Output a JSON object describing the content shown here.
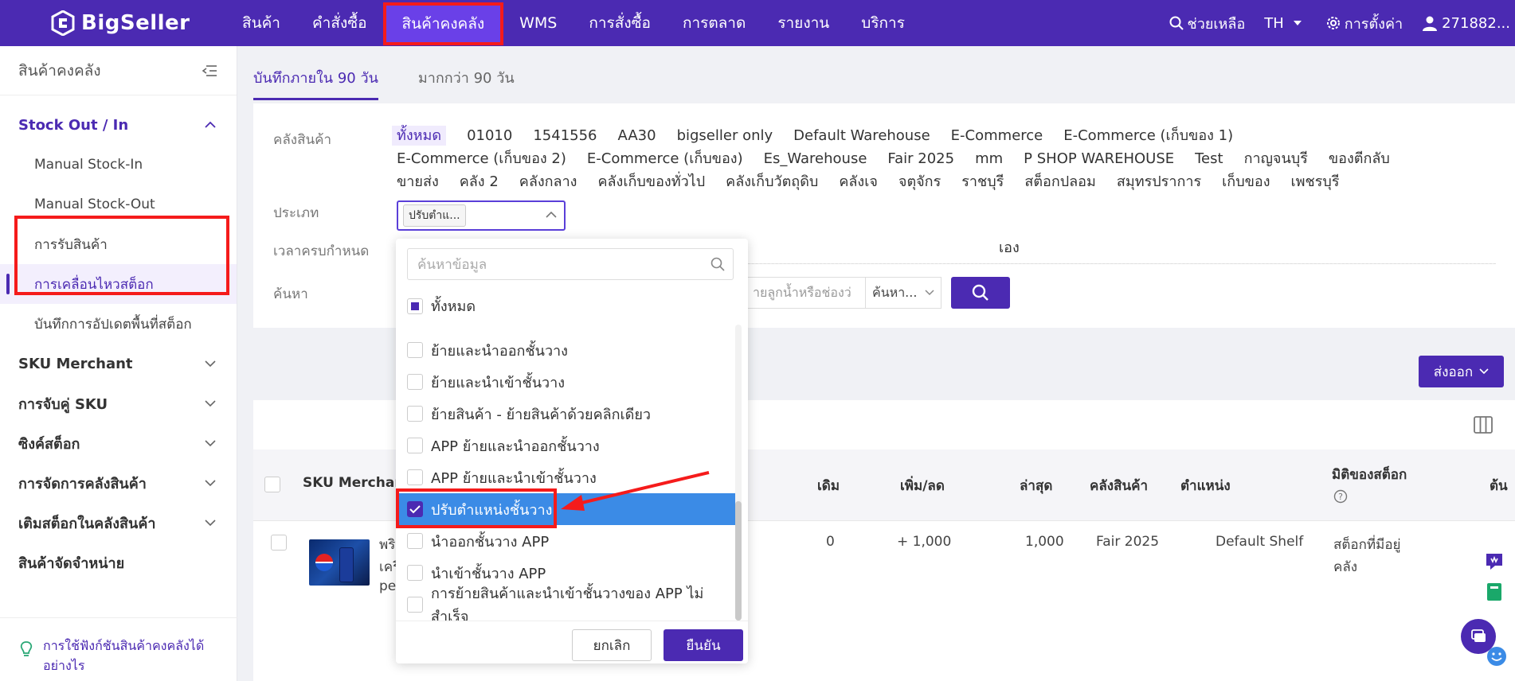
{
  "app": {
    "brand": "BigSeller",
    "nav": [
      "สินค้า",
      "คำสั่งซื้อ",
      "สินค้าคงคลัง",
      "WMS",
      "การสั่งซื้อ",
      "การตลาด",
      "รายงาน",
      "บริการ"
    ],
    "nav_active": "สินค้าคงคลัง",
    "help": "ช่วยเหลือ",
    "lang": "TH",
    "settings": "การตั้งค่า",
    "user": "271882..."
  },
  "sidebar": {
    "title": "สินค้าคงคลัง",
    "open_group": "Stock Out / In",
    "sub_items": [
      "Manual Stock-In",
      "Manual Stock-Out",
      "การรับสินค้า",
      "การเคลื่อนไหวสต็อก",
      "บันทึกการอัปเดตพื้นที่สต็อก"
    ],
    "active_sub": "การเคลื่อนไหวสต็อก",
    "groups": [
      "SKU Merchant",
      "การจับคู่ SKU",
      "ซิงค์สต็อก",
      "การจัดการคลังสินค้า",
      "เติมสต็อกในคลังสินค้า",
      "สินค้าจัดจำหน่าย"
    ],
    "footer": "การใช้ฟังก์ชันสินค้าคงคลังได้อย่างไร"
  },
  "tabs": [
    "บันทึกภายใน 90 วัน",
    "มากกว่า 90 วัน"
  ],
  "filters": {
    "warehouse_label": "คลังสินค้า",
    "warehouses": [
      "ทั้งหมด",
      "01010",
      "1541556",
      "AA30",
      "bigseller only",
      "Default Warehouse",
      "E-Commerce",
      "E-Commerce (เก็บของ 1)",
      "E-Commerce (เก็บของ 2)",
      "E-Commerce (เก็บของ)",
      "Es_Warehouse",
      "Fair 2025",
      "mm",
      "P SHOP WAREHOUSE",
      "Test",
      "กาญจนบุรี",
      "ของตีกลับ",
      "ขายส่ง",
      "คลัง 2",
      "คลังกลาง",
      "คลังเก็บของทั่วไป",
      "คลังเก็บวัตถุดิบ",
      "คลังเจ",
      "จตุจักร",
      "ราชบุรี",
      "สต็อกปลอม",
      "สมุทรปราการ",
      "เก็บของ",
      "เพชรบุรี"
    ],
    "type_label": "ประเภท",
    "type_chip": "ปรับตำแ...",
    "deadline_label": "เวลาครบกำหนด",
    "deadline_tail": "เอง",
    "search_label": "ค้นหา",
    "search_placeholder": "ายลูกน้ำหรือช่องว่",
    "search_mode": "ค้นหา..."
  },
  "dropdown": {
    "search_placeholder": "ค้นหาข้อมูล",
    "all_label": "ทั้งหมด",
    "items": [
      {
        "label": "ย้ายและนำออกชั้นวาง",
        "checked": false
      },
      {
        "label": "ย้ายและนำเข้าชั้นวาง",
        "checked": false
      },
      {
        "label": "ย้ายสินค้า - ย้ายสินค้าด้วยคลิกเดียว",
        "checked": false
      },
      {
        "label": "APP ย้ายและนำออกชั้นวาง",
        "checked": false
      },
      {
        "label": "APP ย้ายและนำเข้าชั้นวาง",
        "checked": false
      },
      {
        "label": "ปรับตำแหน่งชั้นวาง",
        "checked": true
      },
      {
        "label": "นำออกชั้นวาง APP",
        "checked": false
      },
      {
        "label": "นำเข้าชั้นวาง APP",
        "checked": false
      },
      {
        "label": "การย้ายสินค้าและนำเข้าชั้นวางของ APP ไม่สำเร็จ",
        "checked": false
      }
    ],
    "cancel": "ยกเลิก",
    "confirm": "ยืนยัน"
  },
  "export": "ส่งออก",
  "table": {
    "headers": {
      "sku": "SKU Merchant",
      "original": "เดิม",
      "change": "เพิ่ม/ลด",
      "latest": "ล่าสุด",
      "warehouse": "คลังสินค้า",
      "position": "ตำแหน่ง",
      "dimension": "มิติของสต็อก",
      "cut": "ต้น"
    },
    "row": {
      "name_lines": [
        "พริ",
        "เครื",
        "pe"
      ],
      "original": "0",
      "change": "+ 1,000",
      "latest": "1,000",
      "warehouse": "Fair 2025",
      "position": "Default Shelf",
      "dimension_lines": [
        "สต็อกที่มีอยู่",
        "คลัง"
      ]
    }
  },
  "colors": {
    "brand": "#4b2ab2",
    "highlight": "#f51b1b",
    "selected_row": "#3b8be6"
  }
}
